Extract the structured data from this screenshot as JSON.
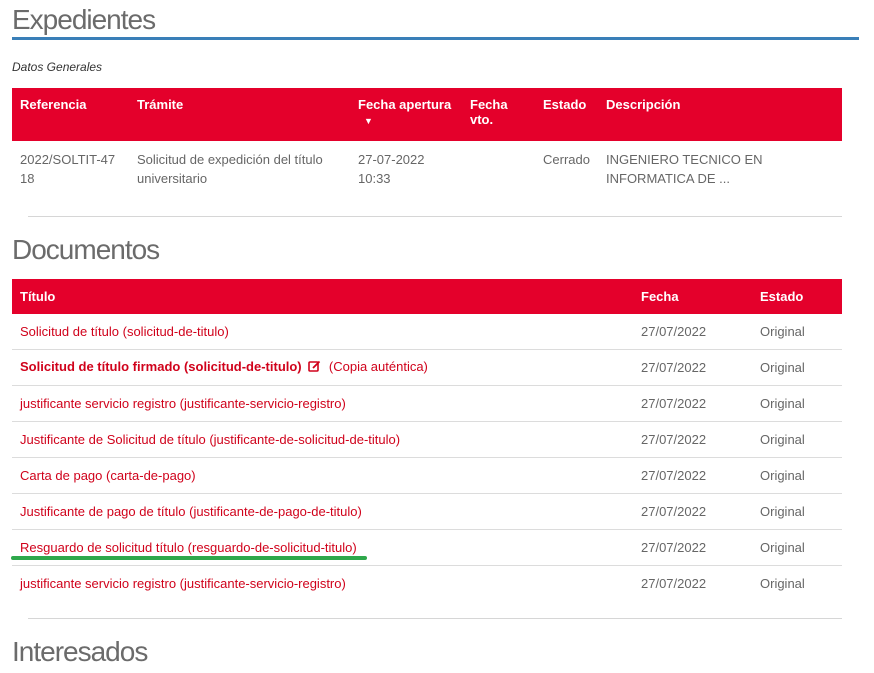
{
  "expedientes": {
    "title": "Expedientes",
    "subtitle": "Datos Generales",
    "headers": {
      "referencia": "Referencia",
      "tramite": "Trámite",
      "fecha_apertura": "Fecha apertura",
      "fecha_vto": "Fecha vto.",
      "estado": "Estado",
      "descripcion": "Descripción"
    },
    "row": {
      "referencia": "2022/SOLTIT-4718",
      "tramite": "Solicitud de expedición del título universitario",
      "fecha_apertura": "27-07-2022 10:33",
      "fecha_vto": "",
      "estado": "Cerrado",
      "descripcion": "INGENIERO TECNICO EN INFORMATICA DE ..."
    },
    "sort_icon": "caret-down-icon"
  },
  "documentos": {
    "title": "Documentos",
    "headers": {
      "titulo": "Título",
      "fecha": "Fecha",
      "estado": "Estado"
    },
    "rows": [
      {
        "titulo": "Solicitud de título (solicitud-de-titulo)",
        "fecha": "27/07/2022",
        "estado": "Original"
      },
      {
        "titulo": "Solicitud de título firmado (solicitud-de-titulo)",
        "extra": "(Copia auténtica)",
        "icon": "edit-signed-icon",
        "fecha": "27/07/2022",
        "estado": "Original"
      },
      {
        "titulo": "justificante servicio registro (justificante-servicio-registro)",
        "fecha": "27/07/2022",
        "estado": "Original"
      },
      {
        "titulo": "Justificante de Solicitud de título (justificante-de-solicitud-de-titulo)",
        "fecha": "27/07/2022",
        "estado": "Original"
      },
      {
        "titulo": "Carta de pago (carta-de-pago)",
        "fecha": "27/07/2022",
        "estado": "Original"
      },
      {
        "titulo": "Justificante de pago de título (justificante-de-pago-de-titulo)",
        "fecha": "27/07/2022",
        "estado": "Original"
      },
      {
        "titulo": "Resguardo de solicitud título (resguardo-de-solicitud-titulo)",
        "fecha": "27/07/2022",
        "estado": "Original"
      },
      {
        "titulo": "justificante servicio registro (justificante-servicio-registro)",
        "fecha": "27/07/2022",
        "estado": "Original"
      }
    ]
  },
  "interesados": {
    "title": "Interesados"
  },
  "colors": {
    "header_red": "#e4002b",
    "link_red": "#d0021b",
    "rule_blue": "#3a7fb8",
    "highlight_green": "#2ea84b"
  }
}
